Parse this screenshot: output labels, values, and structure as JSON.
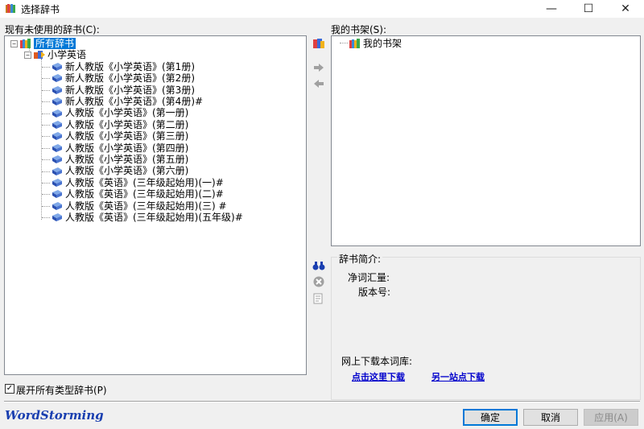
{
  "window": {
    "title": "选择辞书",
    "controls": {
      "minimize": "—",
      "maximize": "☐",
      "close": "✕"
    }
  },
  "left_panel": {
    "label": "现有未使用的辞书(C):",
    "tree": {
      "root": "所有辞书",
      "category": "小学英语",
      "books": [
        "新人教版《小学英语》(第1册)",
        "新人教版《小学英语》(第2册)",
        "新人教版《小学英语》(第3册)",
        "新人教版《小学英语》(第4册)#",
        "人教版《小学英语》(第一册)",
        "人教版《小学英语》(第二册)",
        "人教版《小学英语》(第三册)",
        "人教版《小学英语》(第四册)",
        "人教版《小学英语》(第五册)",
        "人教版《小学英语》(第六册)",
        "人教版《英语》(三年级起始用)(一)#",
        "人教版《英语》(三年级起始用)(二)#",
        "人教版《英语》(三年级起始用)(三) #",
        "人教版《英语》(三年级起始用)(五年级)#"
      ]
    },
    "expand_all_checkbox": {
      "checked": true,
      "mark": "✓",
      "label": "展开所有类型辞书(P)"
    }
  },
  "right_panel": {
    "label": "我的书架(S):",
    "shelf_root": "我的书架"
  },
  "info": {
    "title": "辞书简介:",
    "word_count_label": "净词汇量:",
    "version_label": "版本号:",
    "download_label": "网上下载本词库:",
    "link1": "点击这里下载",
    "link2": "另一站点下载"
  },
  "side_icons": [
    "add-book-icon",
    "move-right-icon",
    "move-left-icon",
    "find-icon",
    "remove-icon",
    "properties-icon"
  ],
  "footer": {
    "brand": "WordStorming",
    "ok": "确定",
    "cancel": "取消",
    "apply": "应用(A)"
  },
  "colors": {
    "selection": "#0078d7",
    "link": "#0000cc",
    "brand": "#1a3fb0"
  }
}
